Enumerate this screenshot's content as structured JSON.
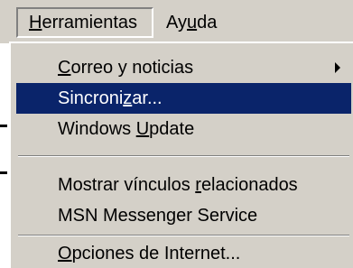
{
  "menubar": {
    "items": [
      {
        "label_pre": "",
        "label_key": "H",
        "label_post": "erramientas"
      },
      {
        "label_pre": "Ay",
        "label_key": "u",
        "label_post": "da"
      }
    ]
  },
  "dropdown": {
    "items": [
      {
        "pre": "",
        "key": "C",
        "post": "orreo y noticias"
      },
      {
        "pre": "Sincroni",
        "key": "z",
        "post": "ar..."
      },
      {
        "pre": "Windows ",
        "key": "U",
        "post": "pdate"
      },
      {
        "pre": "Mostrar vínculos ",
        "key": "r",
        "post": "elacionados"
      },
      {
        "pre": "MSN Messenger Service",
        "key": "",
        "post": ""
      },
      {
        "pre": "",
        "key": "O",
        "post": "pciones de Internet..."
      }
    ]
  },
  "colors": {
    "menu_bg": "#d4d0c8",
    "highlight": "#0a246a",
    "highlight_text": "#ffffff"
  }
}
